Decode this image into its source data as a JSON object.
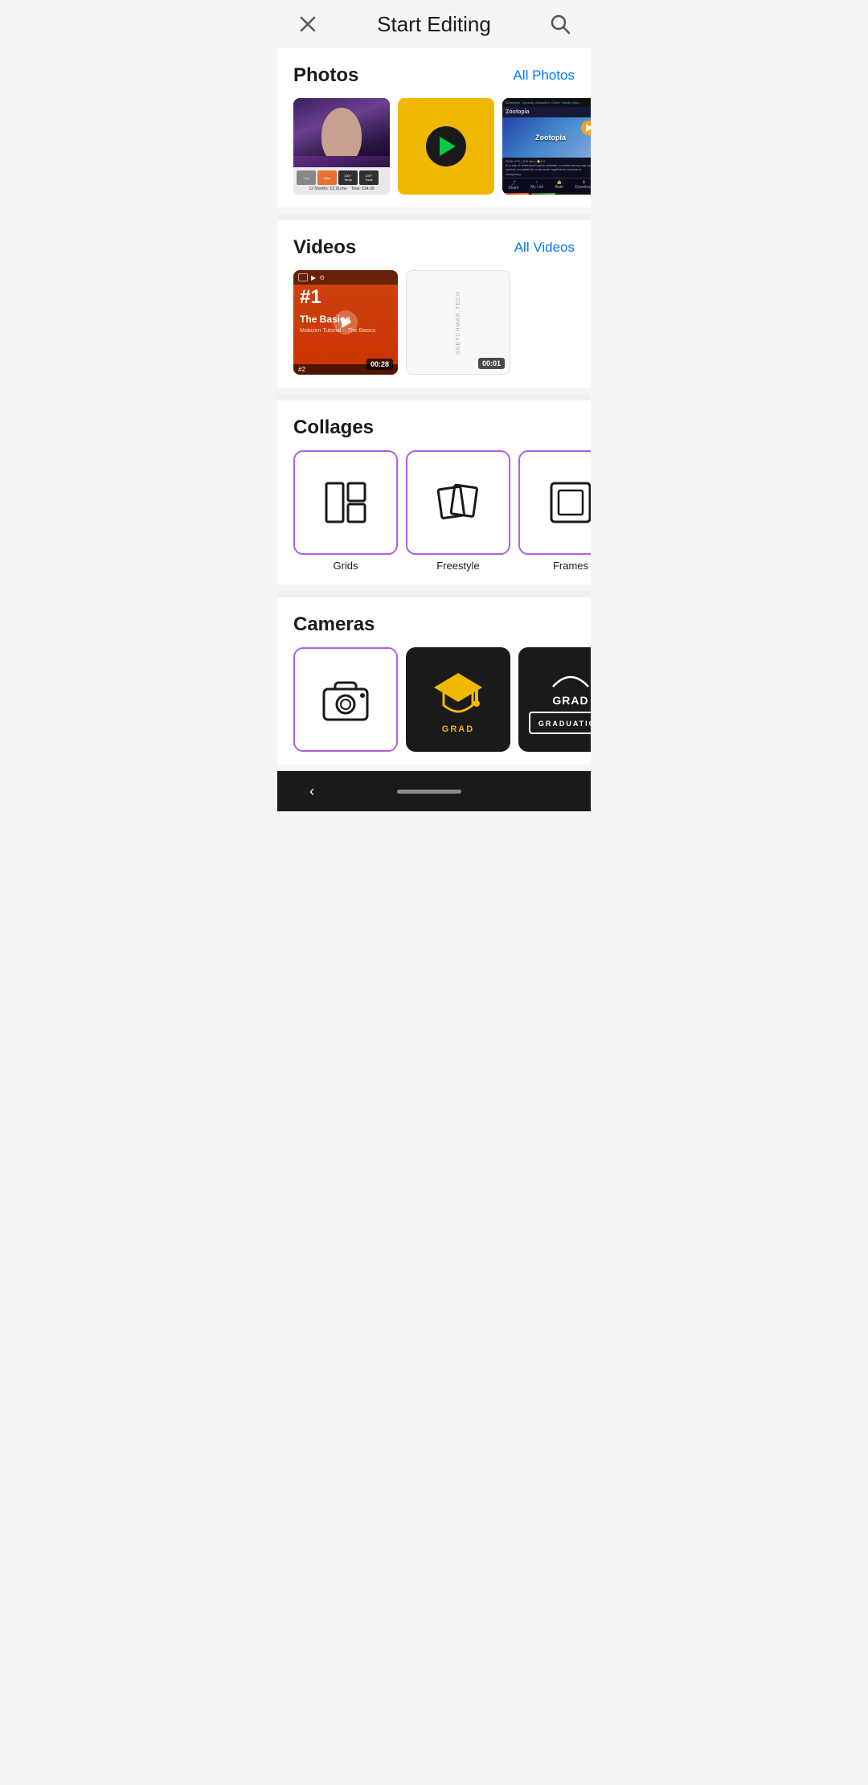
{
  "header": {
    "title": "Start Editing",
    "close_label": "×",
    "search_label": "⌕"
  },
  "photos": {
    "section_title": "Photos",
    "all_link": "All Photos"
  },
  "videos": {
    "section_title": "Videos",
    "all_link": "All Videos",
    "items": [
      {
        "title": "The Basics",
        "subtitle": "#1",
        "caption": "Mobizen Tutorial",
        "duration": "00:28"
      },
      {
        "title": "",
        "subtitle": "",
        "caption": "SKETCHMAR.TECH",
        "duration": "00:01"
      }
    ]
  },
  "collages": {
    "section_title": "Collages",
    "items": [
      {
        "label": "Grids"
      },
      {
        "label": "Freestyle"
      },
      {
        "label": "Frames"
      }
    ]
  },
  "cameras": {
    "section_title": "Cameras"
  },
  "nav": {
    "back_label": "‹"
  }
}
